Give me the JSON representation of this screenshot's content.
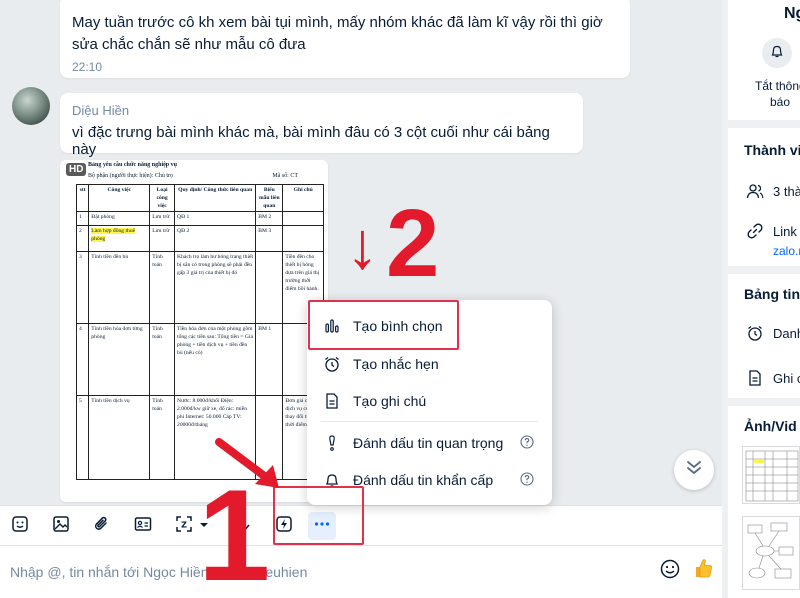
{
  "messages": {
    "prev_text": "May tuần trước cô kh xem bài tụi mình, mấy nhóm khác đã làm kĩ vậy rồi thì giờ sửa chắc chắn sẽ như mẫu cô đưa",
    "prev_time": "22:10",
    "sender": "Diệu Hiền",
    "text": "vì đặc trưng bài mình khác mà, bài mình đâu có 3 cột cuối như cái bảng này"
  },
  "image": {
    "badge": "HD",
    "doc_title": "Bảng yêu cầu chức năng nghiệp vụ",
    "doc_dept": "Bộ phận (người thực hiện): Chủ trọ",
    "doc_code": "Mã số: CT",
    "headers": [
      "stt",
      "Công việc",
      "Loại công việc",
      "Quy định/ Công thức liên quan",
      "Biểu mẫu liên quan",
      "Ghi chú"
    ],
    "rows": [
      [
        "1",
        "Đặt phòng",
        "Lưu trữ",
        "QĐ 1",
        "BM 2",
        ""
      ],
      [
        "2",
        "Làm hợp đồng thuê phòng",
        "Lưu trữ",
        "QĐ 2",
        "BM 3",
        ""
      ],
      [
        "3",
        "Tính tiền đền bù",
        "Tính toán",
        "Khách trọ làm hư hỏng trang thiết bị sẵn có trong phòng sẽ phải đền gấp 3 giá trị của thiết bị đó",
        "",
        "Tiền đền cho thiết bị hỏng dựa trên giá thị trường thời điểm bồi hành."
      ],
      [
        "4",
        "Tính tiền hóa đơn từng phòng",
        "Tính toán",
        "Tiền hóa đơn của một phòng gồm tổng các tiền sau: Tổng tiền = Giá phòng + tiền dịch vụ + tiền đền bù (nếu có)",
        "BM 1",
        ""
      ],
      [
        "5",
        "Tính tiền dịch vụ",
        "Tính toán",
        "Nước: 8.000đ/khối Điện: 2.000đ/kw giữ xe, đổ rác: miễn phí Internet: 50.000 Cáp TV: 20000đ/tháng",
        "",
        "Đơn giá các dịch vụ có thể thay đổi theo thời điểm"
      ]
    ]
  },
  "menu": {
    "poll": "Tạo bình chọn",
    "reminder": "Tạo nhắc hẹn",
    "note": "Tạo ghi chú",
    "mark_important": "Đánh dấu tin quan trọng",
    "mark_urgent": "Đánh dấu tin khẩn cấp"
  },
  "annotations": {
    "step1": "1",
    "step2": "2",
    "arrow": "↓"
  },
  "composer": {
    "placeholder": "Nhập @, tin nhắn tới Ngọc Hiền, huynhdieuhien"
  },
  "sidebar": {
    "name_partial": "Ng",
    "notify_line1": "Tắt thông",
    "notify_line2": "báo",
    "members_head": "Thành vi",
    "members_count": "3 thà",
    "link_label": "Link",
    "link_value": "zalo.n",
    "board_head": "Bảng tin",
    "board_item1": "Danh",
    "board_item2": "Ghi c",
    "media_head": "Ảnh/Vid"
  },
  "colors": {
    "accent": "#0068ff",
    "annotation": "#e21a2b"
  }
}
